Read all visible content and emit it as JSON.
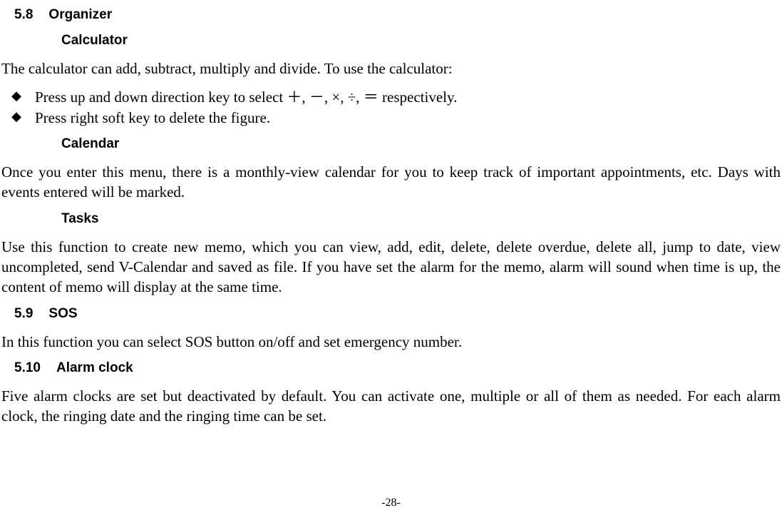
{
  "sections": {
    "organizer": {
      "number": "5.8",
      "title": "Organizer",
      "subsections": {
        "calculator": {
          "title": "Calculator",
          "intro": "The calculator can add, subtract, multiply and divide. To use the calculator:",
          "bullets": [
            "Press up and down direction key to select ＋, －, ×, ÷, ＝ respectively.",
            "Press right soft key to delete the figure."
          ]
        },
        "calendar": {
          "title": "Calendar",
          "text": "Once you enter this menu, there is a monthly-view calendar for you to keep track of important appointments, etc. Days with events entered will be marked."
        },
        "tasks": {
          "title": "Tasks",
          "text": "Use this function to create new memo, which you can view, add, edit, delete, delete overdue, delete all, jump to date, view uncompleted, send V-Calendar and saved as file. If you have set the alarm for the memo, alarm will sound when time is up, the content of memo will display at the same time."
        }
      }
    },
    "sos": {
      "number": "5.9",
      "title": "SOS",
      "text": "In this function you can select SOS button on/off and set emergency number."
    },
    "alarm": {
      "number": "5.10",
      "title": "Alarm clock",
      "text": "Five alarm clocks are set but deactivated by default. You can activate one, multiple or all of them as needed. For each alarm clock, the ringing date and the ringing time can be set."
    }
  },
  "page_number": "-28-"
}
